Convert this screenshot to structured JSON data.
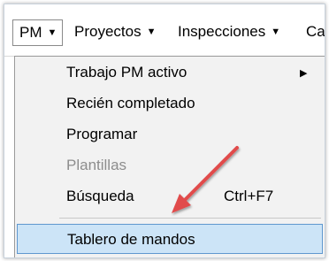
{
  "menubar": {
    "items": [
      {
        "label": "PM"
      },
      {
        "label": "Proyectos"
      },
      {
        "label": "Inspecciones"
      },
      {
        "label": "Cad"
      }
    ]
  },
  "dropdown": {
    "items": [
      {
        "label": "Trabajo PM activo",
        "has_submenu": true
      },
      {
        "label": "Recién completado"
      },
      {
        "label": "Programar"
      },
      {
        "label": "Plantillas",
        "disabled": true
      },
      {
        "label": "Búsqueda",
        "shortcut": "Ctrl+F7"
      },
      {
        "label": "Tablero de mandos",
        "highlighted": true
      }
    ]
  },
  "colors": {
    "highlight": "#cce4f7",
    "arrow": "#e14b4b",
    "disabled_text": "#8d8d8d"
  }
}
